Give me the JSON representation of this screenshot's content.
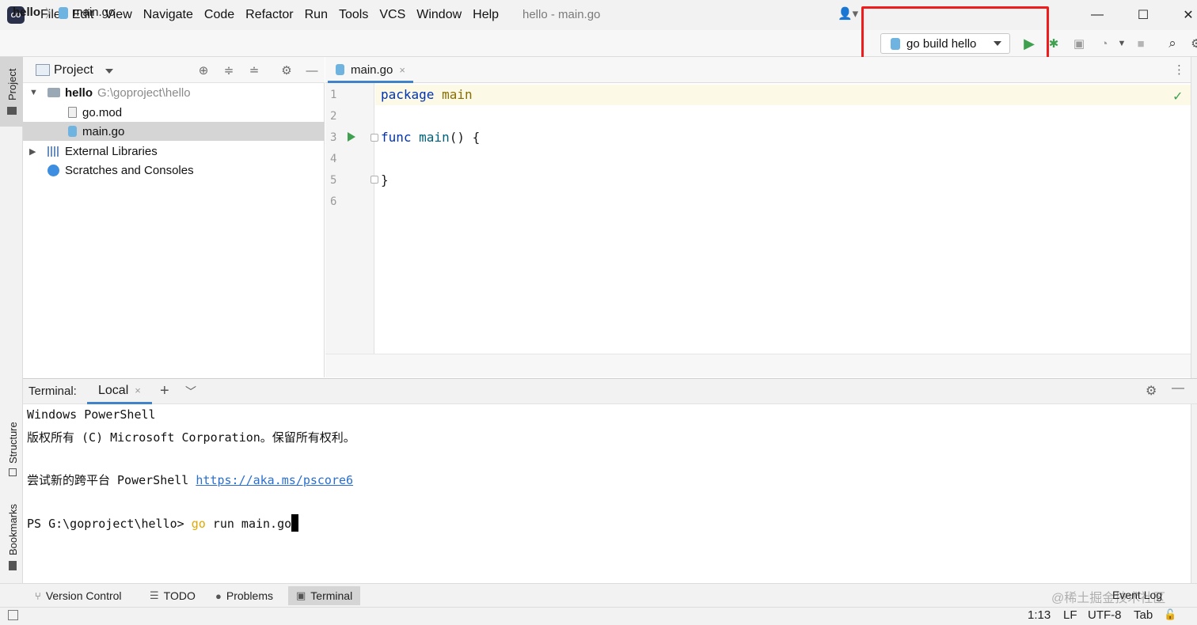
{
  "app": {
    "logo_text": "GO",
    "window_title": "hello - main.go"
  },
  "menu": [
    {
      "label": "File"
    },
    {
      "label": "Edit"
    },
    {
      "label": "View"
    },
    {
      "label": "Navigate"
    },
    {
      "label": "Code"
    },
    {
      "label": "Refactor"
    },
    {
      "label": "Run"
    },
    {
      "label": "Tools"
    },
    {
      "label": "VCS"
    },
    {
      "label": "Window"
    },
    {
      "label": "Help"
    }
  ],
  "window_controls": {
    "minimize": "—",
    "maximize": "☐",
    "close": "✕"
  },
  "breadcrumb": {
    "project": "hello",
    "separator": "〉",
    "file": "main.go"
  },
  "toolbar": {
    "run_config": "go build hello",
    "run_icon": "play-icon",
    "debug_icon": "bug-icon",
    "coverage_icon": "coverage-icon",
    "profile_icon": "profile-icon",
    "stop_icon": "stop-icon",
    "search_icon": "search-icon",
    "settings_icon": "gear-icon",
    "highlight_color": "#ee1c1c"
  },
  "left_stripe": {
    "project": "Project",
    "structure": "Structure",
    "bookmarks": "Bookmarks"
  },
  "project_panel": {
    "title": "Project",
    "tree": [
      {
        "name": "hello",
        "path": "G:\\goproject\\hello"
      },
      {
        "name": "go.mod"
      },
      {
        "name": "main.go"
      },
      {
        "name": "External Libraries"
      },
      {
        "name": "Scratches and Consoles"
      }
    ]
  },
  "editor": {
    "tab_label": "main.go",
    "tab_close": "×",
    "line_numbers": [
      "1",
      "2",
      "3",
      "4",
      "5",
      "6"
    ],
    "code": {
      "l1_kw": "package",
      "l1_name": " main",
      "l3_kw": "func",
      "l3_name": " main",
      "l3_rest": "() {",
      "l5": "}"
    }
  },
  "terminal": {
    "title": "Terminal:",
    "tab_label": "Local",
    "tab_close": "×",
    "add": "+",
    "dropdown": "⌄",
    "lines": {
      "l1": "Windows PowerShell",
      "l2": "版权所有 (C) Microsoft Corporation。保留所有权利。",
      "l3_text": "尝试新的跨平台 PowerShell ",
      "l3_link": "https://aka.ms/pscore6",
      "l4_prompt": "PS G:\\goproject\\hello> ",
      "l4_cmd": "go",
      "l4_args": " run main.go"
    }
  },
  "bottom_tools": [
    {
      "label": "Version Control"
    },
    {
      "label": "TODO"
    },
    {
      "label": "Problems"
    },
    {
      "label": "Terminal"
    }
  ],
  "event_log": "Event Log",
  "watermark": "@稀土掘金技术社区",
  "status": {
    "position": "1:13",
    "line_sep": "LF",
    "encoding": "UTF-8",
    "indent": "Tab"
  }
}
